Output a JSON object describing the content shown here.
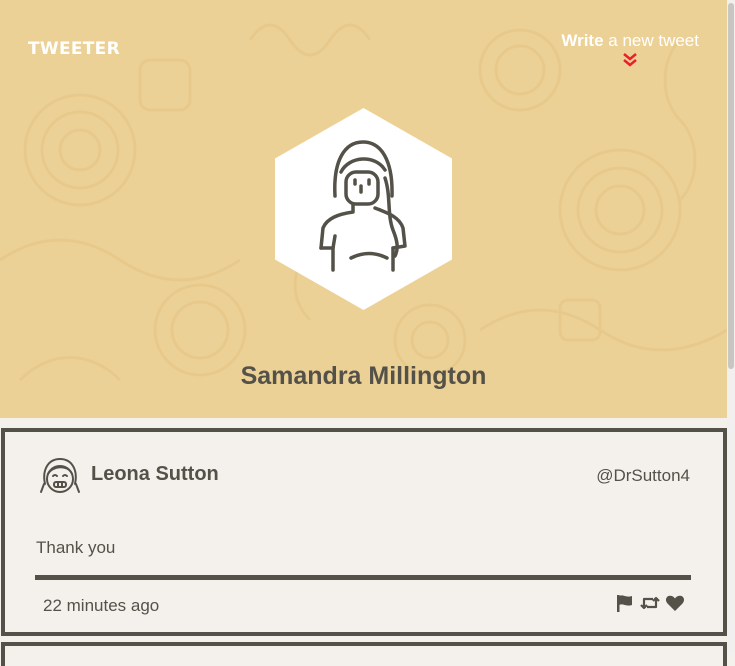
{
  "nav": {
    "logo": "TWEETER",
    "compose_strong": "Write",
    "compose_rest": " a new tweet",
    "compose_icon": "double-chevron-down-icon",
    "compose_icon_color": "#e8202a"
  },
  "profile": {
    "name": "Samandra Millington",
    "avatar_icon": "girl-avatar-icon"
  },
  "tweets": [
    {
      "avatar_icon": "smiling-girl-avatar-icon",
      "name": "Leona Sutton",
      "handle": "@DrSutton4",
      "text": "Thank you",
      "time": "22 minutes ago",
      "actions": [
        "flag-icon",
        "retweet-icon",
        "heart-icon"
      ]
    }
  ],
  "colors": {
    "hero_background": "#ecd196",
    "text": "#545149",
    "page_background": "#f4f1ec"
  }
}
